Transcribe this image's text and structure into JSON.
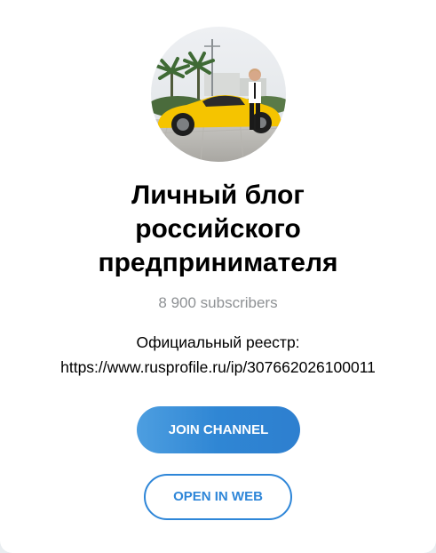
{
  "channel": {
    "title_lines": [
      "Личный блог",
      "российского",
      "предпринимателя"
    ],
    "subscribers": "8 900 subscribers",
    "description_lines": [
      "Официальный реестр:",
      "https://www.rusprofile.ru/ip/307662026100011"
    ]
  },
  "actions": {
    "join_label": "JOIN CHANNEL",
    "open_web_label": "OPEN IN WEB"
  },
  "colors": {
    "accent": "#2e86d8",
    "join_gradient_start": "#4d9ee0",
    "join_gradient_end": "#2e7fcf",
    "muted_text": "#8e9194",
    "car": "#f5c400"
  },
  "avatar": {
    "icon": "channel-avatar-photo"
  }
}
